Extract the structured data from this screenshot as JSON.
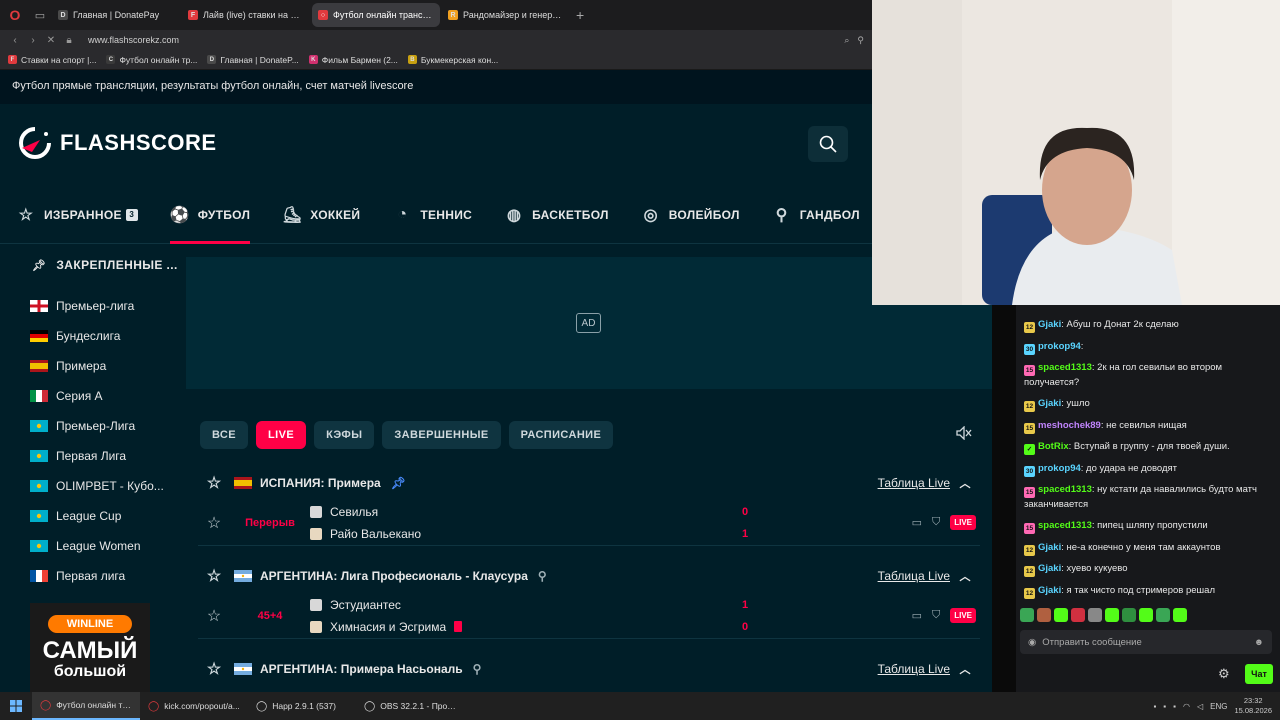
{
  "browser": {
    "tabs": [
      {
        "label": "Главная | DonatePay",
        "fav": "D",
        "color": "#4a4a4a"
      },
      {
        "label": "Лайв (live) ставки на Футб",
        "fav": "F",
        "color": "#e03a3e"
      },
      {
        "label": "Футбол онлайн трансляц",
        "fav": "○",
        "color": "#e03a3e"
      },
      {
        "label": "Рандомайзер и генератор",
        "fav": "R",
        "color": "#f0a020"
      }
    ],
    "active_tab": 2,
    "url": "www.flashscorekz.com",
    "bookmarks": [
      {
        "label": "Ставки на спорт |...",
        "fav": "F",
        "color": "#e03a3e"
      },
      {
        "label": "Футбол онлайн тр...",
        "fav": "C",
        "color": "#3a3a3a"
      },
      {
        "label": "Главная | DonateP...",
        "fav": "D",
        "color": "#4a4a4a"
      },
      {
        "label": "Фильм Бармен (2...",
        "fav": "K",
        "color": "#d0306e"
      },
      {
        "label": "Букмекерская кон...",
        "fav": "B",
        "color": "#c8a010"
      }
    ]
  },
  "page": {
    "title": "Футбол прямые трансляции, результаты футбол онлайн, счет матчей livescore",
    "logo": "FLASHSCORE"
  },
  "sports": [
    {
      "label": "ИЗБРАННОЕ",
      "icon": "star-icon",
      "glyph": "☆",
      "badge": "3"
    },
    {
      "label": "ФУТБОЛ",
      "icon": "soccer-ball-icon",
      "glyph": "⚽",
      "active": true
    },
    {
      "label": "ХОККЕЙ",
      "icon": "hockey-stick-icon",
      "glyph": "⛸"
    },
    {
      "label": "ТЕННИС",
      "icon": "tennis-ball-icon",
      "glyph": "◔"
    },
    {
      "label": "БАСКЕТБОЛ",
      "icon": "basketball-icon",
      "glyph": "◍"
    },
    {
      "label": "ВОЛЕЙБОЛ",
      "icon": "volleyball-icon",
      "glyph": "◎"
    },
    {
      "label": "ГАНДБОЛ",
      "icon": "handball-icon",
      "glyph": "⚲"
    }
  ],
  "sidebar": {
    "title": "ЗАКРЕПЛЕННЫЕ ...",
    "leagues": [
      {
        "label": "Премьер-лига",
        "flag": "england"
      },
      {
        "label": "Бундеслига",
        "flag": "germany"
      },
      {
        "label": "Примера",
        "flag": "spain"
      },
      {
        "label": "Серия А",
        "flag": "italy"
      },
      {
        "label": "Премьер-Лига",
        "flag": "kazakhstan"
      },
      {
        "label": "Первая Лига",
        "flag": "kazakhstan"
      },
      {
        "label": "OLIMPBET - Кубо...",
        "flag": "kazakhstan"
      },
      {
        "label": "League Cup",
        "flag": "kazakhstan"
      },
      {
        "label": "League Women",
        "flag": "kazakhstan"
      },
      {
        "label": "Первая лига",
        "flag": "france"
      }
    ],
    "promo": {
      "brand": "WINLINE",
      "line1": "САМЫЙ",
      "line2": "большой"
    }
  },
  "ad": {
    "label": "AD"
  },
  "filters": [
    "ВСЕ",
    "LIVE",
    "КЭФЫ",
    "ЗАВЕРШЕННЫЕ",
    "РАСПИСАНИЕ"
  ],
  "active_filter": 1,
  "sections": [
    {
      "country": "ИСПАНИЯ",
      "league": "Примера",
      "name": "ИСПАНИЯ: Примера",
      "flag": "spain",
      "pinned": true,
      "table_link": "Таблица Live",
      "matches": [
        {
          "stage": "Перерыв",
          "home": "Севилья",
          "away": "Райо Вальекано",
          "home_score": "0",
          "away_score": "1",
          "live": "LIVE",
          "red_card_away": false
        }
      ]
    },
    {
      "country": "АРГЕНТИНА",
      "league": "Лига Професиональ - Клаусура",
      "name": "АРГЕНТИНА: Лига Професиональ - Клаусура",
      "flag": "argentina",
      "pinned": false,
      "table_link": "Таблица Live",
      "matches": [
        {
          "stage": "45+4",
          "home": "Эстудиантес",
          "away": "Химнасия и Эсгрима",
          "home_score": "1",
          "away_score": "0",
          "live": "LIVE",
          "red_card_away": true
        }
      ]
    },
    {
      "country": "АРГЕНТИНА",
      "league": "Примера Насьональ",
      "name": "АРГЕНТИНА: Примера Насьональ",
      "flag": "argentina",
      "pinned": false,
      "table_link": "Таблица Live",
      "matches": []
    }
  ],
  "chat": {
    "messages": [
      {
        "badge": "12",
        "bcolor": "#e8c84a",
        "user": "Gjaki",
        "ucolor": "#5ad4ff",
        "text": "Абуш го Донат 2к сделаю"
      },
      {
        "badge": "30",
        "bcolor": "#5ad4ff",
        "user": "prokop94",
        "ucolor": "#5ad4ff",
        "text": ""
      },
      {
        "badge": "15",
        "bcolor": "#ff69b4",
        "user": "spaced1313",
        "ucolor": "#53fc18",
        "text": "2к на гол севильи во втором получается?"
      },
      {
        "badge": "12",
        "bcolor": "#e8c84a",
        "user": "Gjaki",
        "ucolor": "#5ad4ff",
        "text": "ушло"
      },
      {
        "badge": "15",
        "bcolor": "#e8c84a",
        "user": "meshochek89",
        "ucolor": "#c084fc",
        "text": "не севилья нищая"
      },
      {
        "badge": "✓",
        "bcolor": "#53fc18",
        "user": "BotRix",
        "ucolor": "#53fc18",
        "text": "Вступай в группу - для твоей души."
      },
      {
        "badge": "30",
        "bcolor": "#5ad4ff",
        "user": "prokop94",
        "ucolor": "#5ad4ff",
        "text": "до удара не доводят"
      },
      {
        "badge": "15",
        "bcolor": "#ff69b4",
        "user": "spaced1313",
        "ucolor": "#53fc18",
        "text": "ну кстати да навалились будто матч заканчивается"
      },
      {
        "badge": "15",
        "bcolor": "#ff69b4",
        "user": "spaced1313",
        "ucolor": "#53fc18",
        "text": "пипец шляпу пропустили"
      },
      {
        "badge": "12",
        "bcolor": "#e8c84a",
        "user": "Gjaki",
        "ucolor": "#5ad4ff",
        "text": "не-а конечно у меня там аккаунтов"
      },
      {
        "badge": "12",
        "bcolor": "#e8c84a",
        "user": "Gjaki",
        "ucolor": "#5ad4ff",
        "text": "хуево кукуево"
      },
      {
        "badge": "12",
        "bcolor": "#e8c84a",
        "user": "Gjaki",
        "ucolor": "#5ad4ff",
        "text": "я так чисто под стримеров решал"
      }
    ],
    "input_placeholder": "Отправить сообщение",
    "send_label": "Чат"
  },
  "taskbar": {
    "items": [
      {
        "label": "Футбол онлайн тр...",
        "active": true,
        "icon": "opera-icon"
      },
      {
        "label": "kick.com/popout/a...",
        "active": false,
        "icon": "opera-icon"
      },
      {
        "label": "Happ 2.9.1 (537)",
        "active": false,
        "icon": "happ-icon"
      },
      {
        "label": "OBS 32.2.1 - Проф...",
        "active": false,
        "icon": "obs-icon"
      }
    ],
    "lang": "ENG",
    "time": "23:32",
    "date": "15.08.2026"
  }
}
